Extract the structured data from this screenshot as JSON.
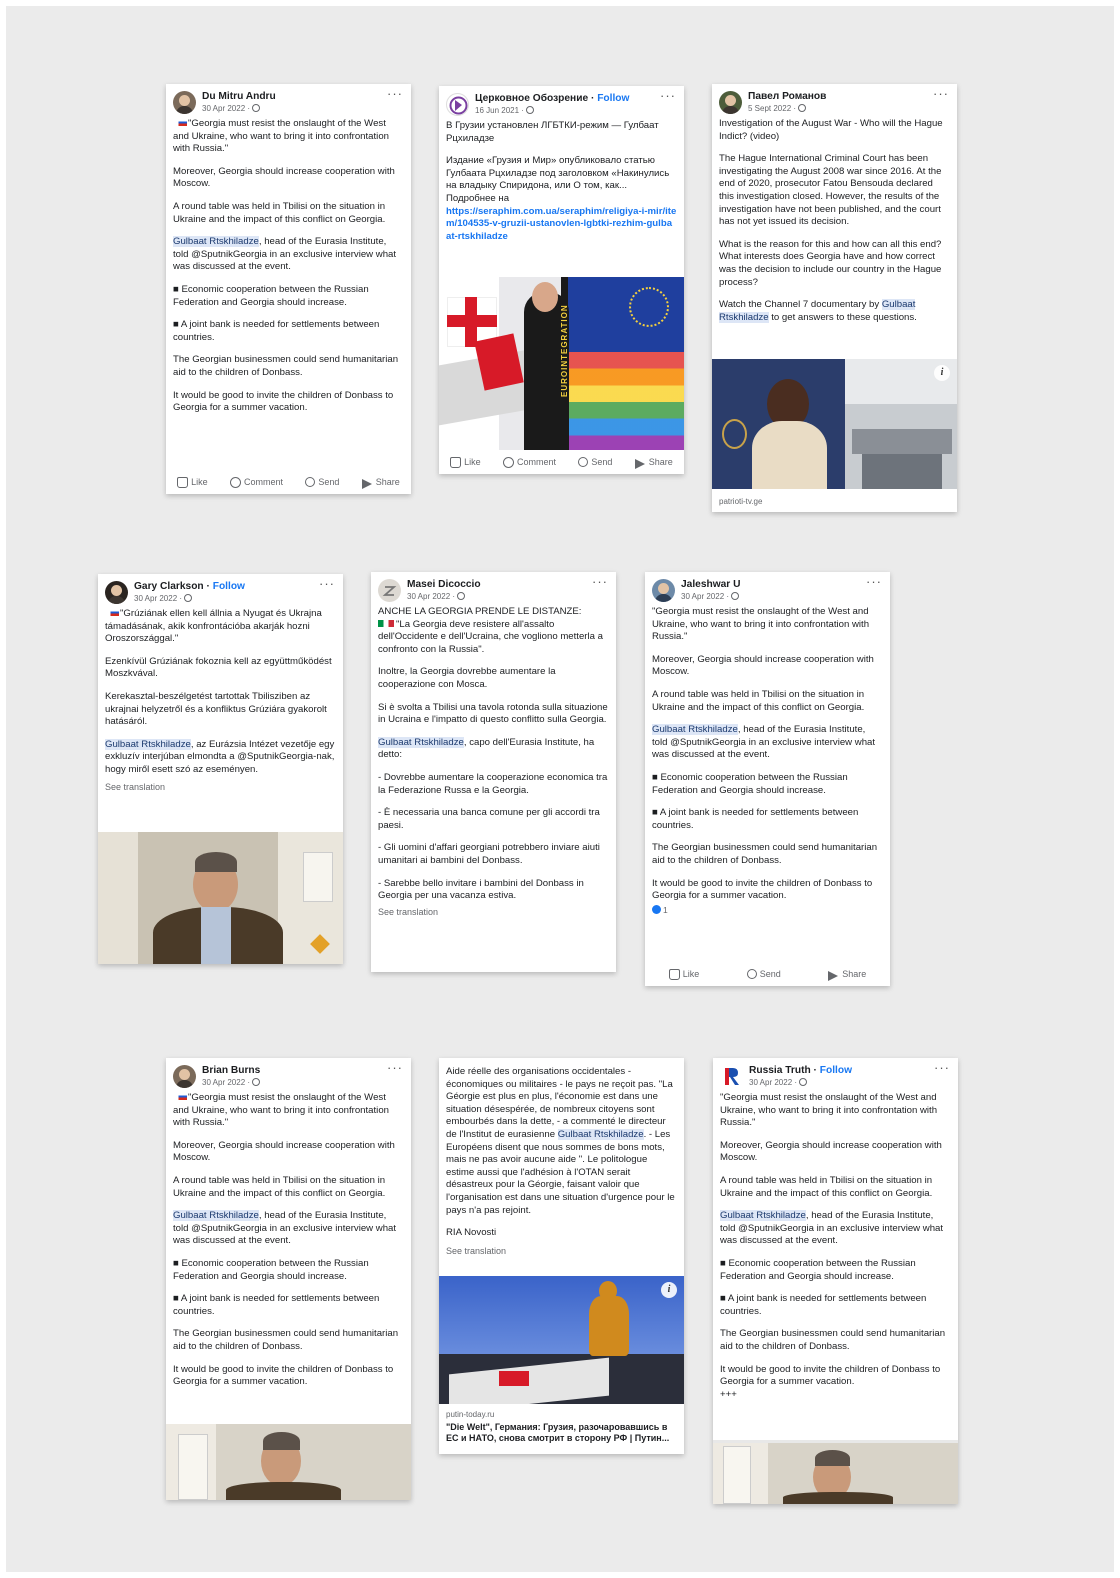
{
  "ui": {
    "like": "Like",
    "comment": "Comment",
    "send": "Send",
    "share": "Share",
    "follow": "Follow",
    "see_translation": "See translation",
    "more": "···",
    "info": "i"
  },
  "posts": [
    {
      "name": "Du Mitru Andru",
      "date": "30 Apr 2022 ·",
      "paras": [
        "\"Georgia must resist the onslaught of the West and Ukraine, who want to bring it into confrontation with Russia.\"",
        "Moreover, Georgia should increase cooperation with Moscow.",
        "A round table was held in Tbilisi on the situation in Ukraine and the impact of this conflict on Georgia.",
        ", head of the Eurasia Institute, told @SputnikGeorgia in an exclusive interview what was discussed at the event.",
        "■ Economic cooperation between the Russian Federation and Georgia should increase.",
        "■ A joint bank is needed for settlements between countries.",
        "The Georgian businessmen could send humanitarian aid to the children of Donbass.",
        "It would be good to invite the children of Donbass to Georgia for a summer vacation."
      ],
      "highlight": "Gulbaat Rtskhiladze"
    },
    {
      "name": "Церковное Обозрение",
      "date": "16 Jun 2021 ·",
      "paras": [
        "В Грузии установлен ЛГБТКИ-режим — Гулбаат Рцхиладзе",
        "Издание «Грузия и Мир» опубликовало статью Гулбаата Рцхиладзе под заголовком «Накинулись на владыку Спиридона, или О том, как...",
        "Подробнее на"
      ],
      "link": "https://seraphim.com.ua/seraphim/religiya-i-mir/item/104535-v-gruzii-ustanovlen-lgbtki-rezhim-gulbaat-rtskhiladze",
      "image_text": "EUROINTEGRATION"
    },
    {
      "name": "Павел Романов",
      "date": "5 Sept 2022 ·",
      "paras": [
        "Investigation of the August War - Who will the Hague Indict? (video)",
        "The Hague International Criminal Court has been investigating the August 2008 war since 2016. At the end of 2020, prosecutor Fatou Bensouda declared this investigation closed. However, the results of the investigation have not been published, and the court has not yet issued its decision.",
        "What is the reason for this and how can all this end? What interests does Georgia have and how correct was the decision to include our country in the Hague process?",
        "Watch the Channel 7 documentary by ",
        " to get answers to these questions."
      ],
      "highlight": "Gulbaat Rtskhiladze",
      "source": "patrioti-tv.ge"
    },
    {
      "name": "Gary Clarkson",
      "date": "30 Apr 2022 ·",
      "paras": [
        "\"Grúziának ellen kell állnia a Nyugat és Ukrajna támadásának, akik konfrontációba akarják hozni Oroszországgal.\"",
        "Ezenkívül Grúziának fokoznia kell az együttműködést Moszkvával.",
        "Kerekasztal-beszélgetést tartottak Tbilisziben az ukrajnai helyzetről és a konfliktus Grúziára gyakorolt hatásáról.",
        ", az Eurázsia Intézet vezetője egy exkluzív interjúban elmondta a @SputnikGeorgia-nak, hogy miről esett szó az eseményen."
      ],
      "highlight": "Gulbaat Rtskhiladze"
    },
    {
      "name": "Masei Dicoccio",
      "date": "30 Apr 2022 ·",
      "paras": [
        "ANCHE LA GEORGIA PRENDE LE DISTANZE:",
        "\"La Georgia deve resistere all'assalto dell'Occidente e dell'Ucraina, che vogliono metterla a confronto con la Russia\".",
        "Inoltre, la Georgia dovrebbe aumentare la cooperazione con Mosca.",
        "Si è svolta a Tbilisi una tavola rotonda sulla situazione in Ucraina e l'impatto di questo conflitto sulla Georgia.",
        ", capo dell'Eurasia Institute, ha detto:",
        "- Dovrebbe aumentare la cooperazione economica tra la Federazione Russa e la Georgia.",
        "- È necessaria una banca comune per gli accordi tra paesi.",
        "- Gli uomini d'affari georgiani potrebbero inviare aiuti umanitari ai bambini del Donbass.",
        "- Sarebbe bello invitare i bambini del Donbass in Georgia per una vacanza estiva."
      ],
      "highlight": "Gulbaat Rtskhiladze"
    },
    {
      "name": "Jaleshwar U",
      "date": "30 Apr 2022 ·",
      "paras": [
        "\"Georgia must resist the onslaught of the West and Ukraine, who want to bring it into confrontation with Russia.\"",
        "Moreover, Georgia should increase cooperation with Moscow.",
        "A round table was held in Tbilisi on the situation in Ukraine and the impact of this conflict on Georgia.",
        ", head of the Eurasia Institute, told @SputnikGeorgia in an exclusive interview what was discussed at the event.",
        "■ Economic cooperation between the Russian Federation and Georgia should increase.",
        "■ A joint bank is needed for settlements between countries.",
        "The Georgian businessmen could send humanitarian aid to the children of Donbass.",
        "It would be good to invite the children of Donbass to Georgia for a summer vacation."
      ],
      "highlight": "Gulbaat Rtskhiladze",
      "reactions": "1"
    },
    {
      "name": "Brian Burns",
      "date": "30 Apr 2022 ·",
      "paras": [
        "\"Georgia must resist the onslaught of the West and Ukraine, who want to bring it into confrontation with Russia.\"",
        "Moreover, Georgia should increase cooperation with Moscow.",
        "A round table was held in Tbilisi on the situation in Ukraine and the impact of this conflict on Georgia.",
        ", head of the Eurasia Institute, told @SputnikGeorgia in an exclusive interview what was discussed at the event.",
        "■ Economic cooperation between the Russian Federation and Georgia should increase.",
        "■ A joint bank is needed for settlements between countries.",
        "The Georgian businessmen could send humanitarian aid to the children of Donbass.",
        "It would be good to invite the children of Donbass to Georgia for a summer vacation."
      ],
      "highlight": "Gulbaat Rtskhiladze"
    },
    {
      "name": "",
      "paras": [
        "Aide réelle des organisations occidentales - économiques ou militaires - le pays ne reçoit pas. \"La Géorgie est plus en plus, l'économie est dans une situation désespérée, de nombreux citoyens sont embourbés dans la dette, - a commenté le directeur de l'Institut de eurasienne ",
        ". - Les Européens disent que nous sommes de bons mots, mais ne pas avoir aucune aide \". Le politologue estime aussi que l'adhésion à l'OTAN serait désastreux pour la Géorgie, faisant valoir que l'organisation est dans une situation d'urgence pour le pays n'a pas rejoint.",
        "RIA Novosti"
      ],
      "highlight": "Gulbaat Rtskhiladze",
      "source": "putin-today.ru",
      "link_title": "\"Die Welt\", Германия: Грузия, разочаровавшись в ЕС и НАТО, снова смотрит в сторону РФ | Путин..."
    },
    {
      "name": "Russia Truth",
      "date": "30 Apr 2022 ·",
      "paras": [
        "\"Georgia must resist the onslaught of the West and Ukraine, who want to bring it into confrontation with Russia.\"",
        "Moreover, Georgia should increase cooperation with Moscow.",
        "A round table was held in Tbilisi on the situation in Ukraine and the impact of this conflict on Georgia.",
        ", head of the Eurasia Institute, told @SputnikGeorgia in an exclusive interview what was discussed at the event.",
        "■ Economic cooperation between the Russian Federation and Georgia should increase.",
        "■ A joint bank is needed for settlements between countries.",
        "The Georgian businessmen could send humanitarian aid to the children of Donbass.",
        "It would be good to invite the children of Donbass to Georgia for a summer vacation.",
        "+++"
      ],
      "highlight": "Gulbaat Rtskhiladze"
    }
  ],
  "colors": {
    "background": "#ebebeb",
    "link": "#1877f2",
    "highlight": "#dde6f6"
  }
}
